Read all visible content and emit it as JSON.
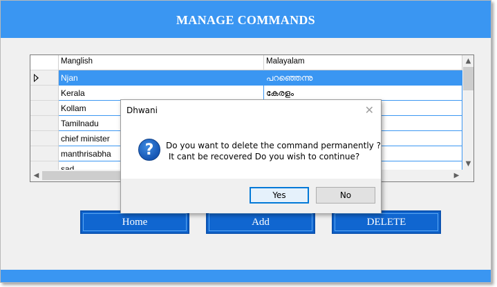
{
  "app": {
    "title": "MANAGE COMMANDS"
  },
  "grid": {
    "columns": [
      "Manglish",
      "Malayalam"
    ],
    "rows": [
      {
        "manglish": "Njan",
        "malayalam": "പറഞ്ഞെന്നു",
        "selected": true
      },
      {
        "manglish": "Kerala",
        "malayalam": "കേരളം",
        "selected": false
      },
      {
        "manglish": "Kollam",
        "malayalam": "",
        "selected": false
      },
      {
        "manglish": "Tamilnadu",
        "malayalam": "",
        "selected": false
      },
      {
        "manglish": "chief minister",
        "malayalam": "",
        "selected": false
      },
      {
        "manglish": "manthrisabha",
        "malayalam": "",
        "selected": false
      },
      {
        "manglish": "sad",
        "malayalam": "",
        "selected": false
      }
    ],
    "scroll_up": "▲",
    "scroll_down": "▼",
    "scroll_left": "◀",
    "scroll_right": "▶"
  },
  "buttons": {
    "home": "Home",
    "add": "Add",
    "delete": "DELETE"
  },
  "dialog": {
    "title": "Dhwani",
    "close": "✕",
    "icon": "question-icon",
    "icon_glyph": "?",
    "message_line1": "Do you want to delete the command permanently ?",
    "message_line2": " It cant be recovered Do you wish to continue?",
    "yes": "Yes",
    "no": "No"
  },
  "colors": {
    "accent": "#3a96f2",
    "button": "#1066d0"
  }
}
